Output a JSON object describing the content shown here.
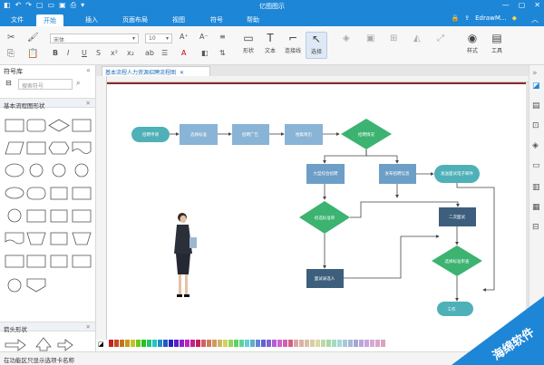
{
  "window": {
    "title": "亿图图示",
    "user": "EdrawM..."
  },
  "menu": {
    "tabs": [
      "文件",
      "开始",
      "插入",
      "页面布局",
      "视图",
      "符号",
      "帮助"
    ],
    "active": "开始"
  },
  "ribbon": {
    "font_name": "宋体",
    "font_size": "10",
    "tools": [
      {
        "label": "形状",
        "icon": "shape-icon"
      },
      {
        "label": "文本",
        "icon": "text-icon"
      },
      {
        "label": "连接线",
        "icon": "connector-icon"
      },
      {
        "label": "选择",
        "icon": "select-icon"
      }
    ],
    "style_label": "样式",
    "tool_label": "工具"
  },
  "sidebar": {
    "title": "符号库",
    "search_placeholder": "搜索符号",
    "section1": "基本流程图形状",
    "section2": "箭头形状"
  },
  "document": {
    "tab_title": "基本流程人力资源招聘流程图"
  },
  "flowchart": {
    "nodes": [
      "招聘申请",
      "选择标准",
      "招聘广告",
      "搜集简历",
      "招聘情况",
      "大型综合招聘",
      "发布招聘信息",
      "发送面试电子邮件",
      "初选标准审",
      "二次面试",
      "面试录选人",
      "选择标准审查",
      "工作"
    ]
  },
  "status": {
    "text": "在功能区只显示选项卡名称"
  },
  "watermark": {
    "text": "海绵软件"
  },
  "colors": {
    "accent": "#1e86d6",
    "node_fill": "#8ab4d6",
    "teal": "#4fb0b8",
    "decision": "#3cb371",
    "dark_node": "#3d5f7d"
  }
}
